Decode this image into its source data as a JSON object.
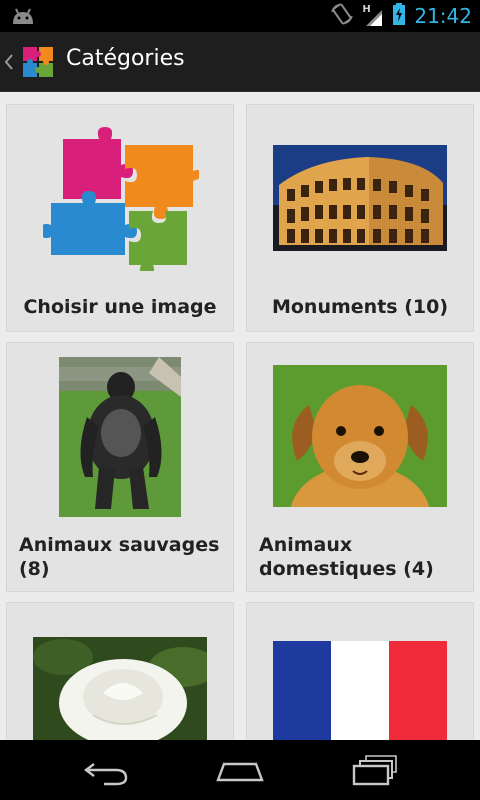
{
  "status_bar": {
    "time": "21:42",
    "network_label": "H",
    "icons": [
      "android-debug-icon",
      "rotation-icon",
      "signal-icon",
      "battery-charging-icon"
    ]
  },
  "action_bar": {
    "title": "Catégories",
    "icons": [
      "up-chevron-icon",
      "puzzle-app-icon"
    ]
  },
  "categories": [
    {
      "label": "Choisir une image",
      "image": "puzzle-pieces-image"
    },
    {
      "label": "Monuments (10)",
      "image": "colosseum-photo"
    },
    {
      "label": "Animaux sauvages (8)",
      "image": "gorilla-photo"
    },
    {
      "label": "Animaux domestiques (4)",
      "image": "puppy-photo"
    },
    {
      "label": "",
      "image": "white-rose-photo"
    },
    {
      "label": "",
      "image": "french-flag-image"
    }
  ],
  "nav_bar": {
    "buttons": [
      "back-icon",
      "home-icon",
      "recent-apps-icon"
    ]
  },
  "colors": {
    "accent": "#33b5e5",
    "action_bar": "#1e1e1e",
    "content_bg": "#ececec",
    "tile_bg": "#e3e3e3"
  }
}
